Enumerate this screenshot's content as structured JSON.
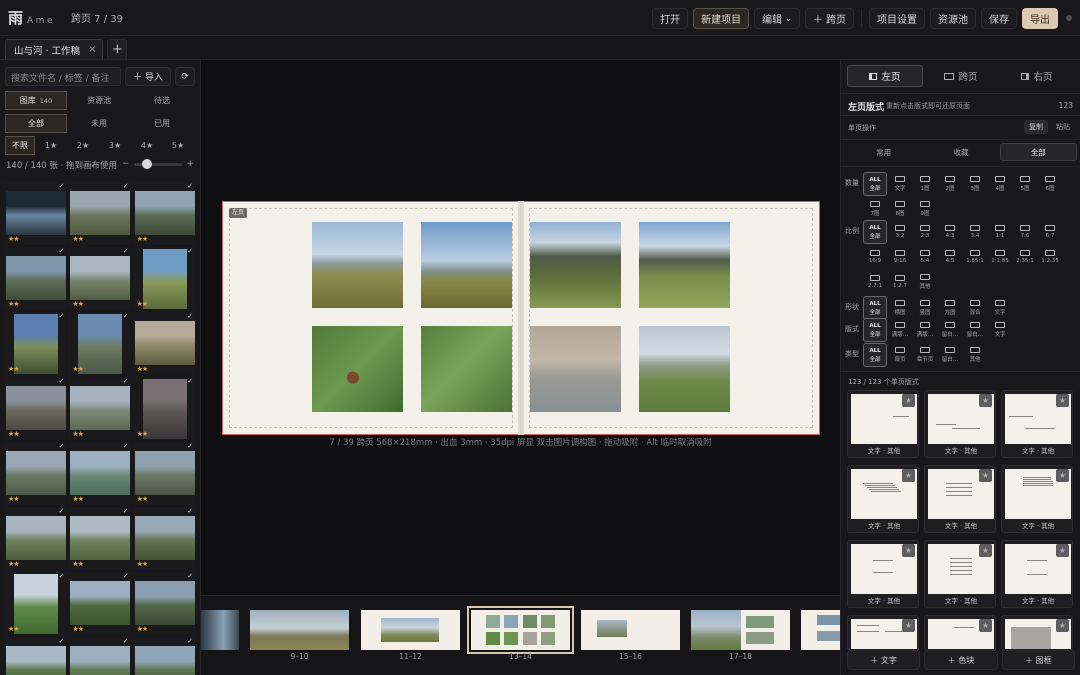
{
  "app": {
    "brand_glyph": "雨",
    "brand_name": "Ame",
    "spread_indicator": "跨页 7 / 39"
  },
  "toolbar": {
    "open": "打开",
    "new_project": "新建项目",
    "edit": "编辑",
    "edit_chevron": "⌄",
    "add_spread": "＋ 跨页",
    "project_settings": "项目设置",
    "resource_pool": "资源池",
    "save": "保存",
    "export": "导出"
  },
  "tabs": {
    "doc_name": "山与河 · 工作稿",
    "close": "×",
    "add": "+"
  },
  "library": {
    "search_placeholder": "搜索文件名 / 标签 / 备注",
    "import_label": "＋ 导入",
    "refresh_icon": "⟳",
    "views": [
      {
        "label": "图库",
        "count": "140"
      },
      {
        "label": "资源池",
        "count": ""
      },
      {
        "label": "待选",
        "count": ""
      }
    ],
    "usage": [
      "全部",
      "未用",
      "已用"
    ],
    "ratings": [
      "不限",
      "1★",
      "2★",
      "3★",
      "4★",
      "5★"
    ],
    "count_text": "140 / 140 张 · 拖到画布使用",
    "zoom_minus": "−",
    "zoom_plus": "+",
    "thumb_stars": "★★",
    "thumb_check": "✓"
  },
  "canvas": {
    "page_tag": "左页",
    "info": "7 / 39   跨页 568×218mm · 出血 3mm · 35dpi 屏显   双击图片调构图 · 拖动吸附 · Alt 临时取消吸附"
  },
  "filmstrip": {
    "labels": [
      "9–10",
      "11–12",
      "13–14",
      "15–16",
      "17–18"
    ]
  },
  "right": {
    "tabs": [
      "左页",
      "跨页",
      "右页"
    ],
    "title": "左页版式",
    "hint": "重新点击版式即可还原页面",
    "count": "123",
    "single_ops": "单页操作",
    "copy": "复制",
    "paste": "粘贴",
    "filters": [
      "常用",
      "收藏",
      "全部"
    ],
    "rows": [
      {
        "label": "数量",
        "options": [
          "文字",
          "1图",
          "2图",
          "3图",
          "4图",
          "5图",
          "6图",
          "7图",
          "8图",
          "9图"
        ]
      },
      {
        "label": "比例",
        "options": [
          "3:2",
          "2:3",
          "4:3",
          "3:4",
          "1:1",
          "7:6",
          "6:7",
          "16:9",
          "9:16",
          "5:4",
          "4:5",
          "1.85:1",
          "1:1.85",
          "2.35:1",
          "1:2.35",
          "2.7:1",
          "1:2.7",
          "其他"
        ]
      },
      {
        "label": "形状",
        "options": [
          "横图",
          "竖图",
          "方图",
          "混合",
          "文字"
        ]
      },
      {
        "label": "版式",
        "options": [
          "满版…",
          "满版…",
          "留白…",
          "留白…",
          "文字"
        ]
      },
      {
        "label": "类型",
        "options": [
          "扉页",
          "章节页",
          "留白…",
          "其他"
        ]
      }
    ],
    "all_top": "ALL",
    "all_bottom": "全部",
    "layout_count": "123 / 123 个单页版式",
    "card_caption": "文字 · 其他",
    "star_icon": "★",
    "footer": [
      "＋ 文字",
      "＋ 色块",
      "＋ 图框"
    ]
  },
  "colors": {
    "accent": "#dcc9b2",
    "star": "#d5a84a",
    "paper": "#f4f1ea"
  }
}
